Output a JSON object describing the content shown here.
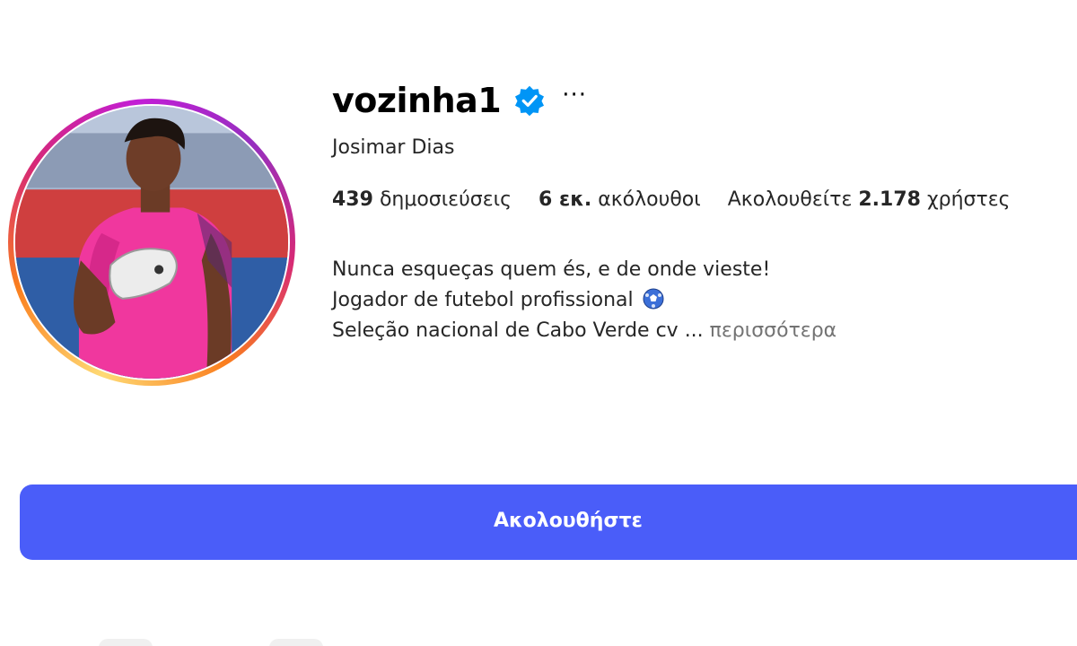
{
  "profile": {
    "username": "vozinha1",
    "full_name": "Josimar Dias",
    "more_options": "···"
  },
  "stats": {
    "posts_count": "439",
    "posts_label": "δημοσιεύσεις",
    "followers_count": "6 εκ.",
    "followers_label": "ακόλουθοι",
    "following_prefix": "Ακολουθείτε",
    "following_count": "2.178",
    "following_label": "χρήστες"
  },
  "bio": {
    "line1": "Nunca esqueças quem és, e de onde vieste!",
    "line2": "Jogador de futebol profissional",
    "line3": "Seleção nacional de Cabo Verde cv ...",
    "more_link": "περισσότερα"
  },
  "actions": {
    "follow_label": "Ακολουθήστε"
  },
  "colors": {
    "follow_button": "#4a5df9",
    "verified_badge": "#0095f6",
    "more_link": "#737373"
  },
  "icons": {
    "verified": "verified-badge-icon",
    "more": "more-options-icon",
    "bio_emoji": "soccer-ball-icon"
  }
}
